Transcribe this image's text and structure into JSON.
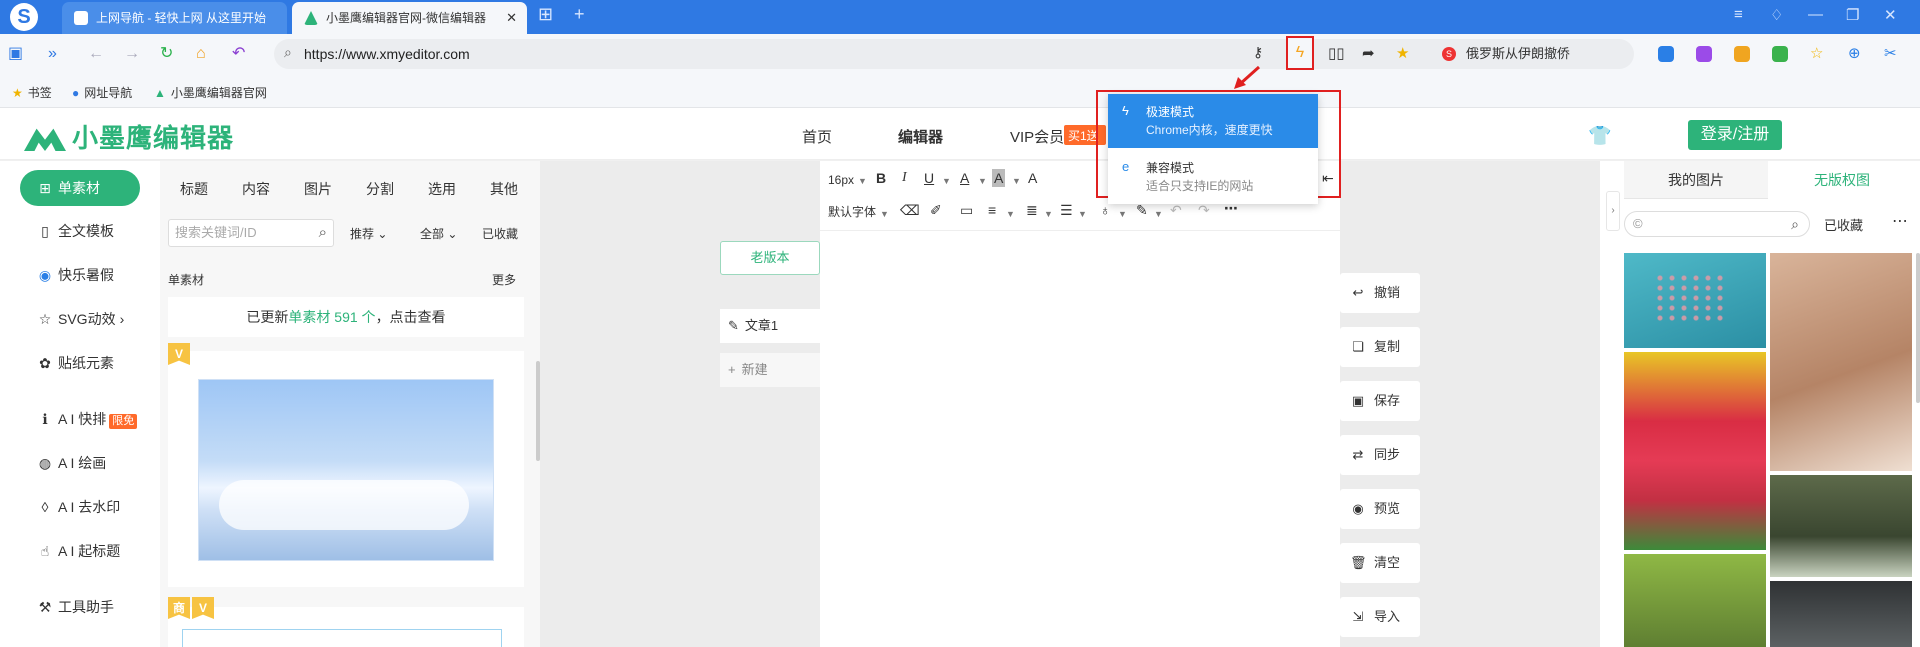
{
  "browser": {
    "tabs": [
      {
        "title": "上网导航 - 轻快上网 从这里开始"
      },
      {
        "title": "小墨鹰编辑器官网-微信编辑器"
      }
    ],
    "url": "https://www.xmyeditor.com",
    "search_text": "俄罗斯从伊朗撤侨",
    "bookmarks": [
      {
        "label": "书签"
      },
      {
        "label": "网址导航"
      },
      {
        "label": "小墨鹰编辑器官网"
      }
    ],
    "mode_menu": {
      "fast": {
        "title": "极速模式",
        "desc": "Chrome内核，速度更快"
      },
      "compat": {
        "title": "兼容模式",
        "desc": "适合只支持IE的网站"
      }
    }
  },
  "site": {
    "brand": "小墨鹰编辑器",
    "nav": [
      {
        "label": "首页"
      },
      {
        "label": "编辑器"
      },
      {
        "label": "VIP会员"
      }
    ],
    "vip_tag": "买1送1",
    "login_label": "登录/注册"
  },
  "left_nav": [
    {
      "label": "单素材",
      "icon": "grid-icon"
    },
    {
      "label": "全文模板",
      "icon": "template-icon"
    },
    {
      "label": "快乐暑假",
      "icon": "ball-icon"
    },
    {
      "label": "SVG动效",
      "icon": "star-icon"
    },
    {
      "label": "贴纸元素",
      "icon": "sticker-icon"
    },
    {
      "label": "A I 快排",
      "icon": "ai-icon",
      "badge": "限免"
    },
    {
      "label": "A I 绘画",
      "icon": "palette-icon"
    },
    {
      "label": "A I 去水印",
      "icon": "drop-icon"
    },
    {
      "label": "A I 起标题",
      "icon": "hand-icon"
    },
    {
      "label": "工具助手",
      "icon": "tool-icon"
    }
  ],
  "material": {
    "tabs": [
      {
        "label": "标题"
      },
      {
        "label": "内容"
      },
      {
        "label": "图片"
      },
      {
        "label": "分割"
      },
      {
        "label": "选用"
      },
      {
        "label": "其他"
      }
    ],
    "search_placeholder": "搜索关键词/ID",
    "filter_recommend": "推荐",
    "filter_all": "全部",
    "collected": "已收藏",
    "section_title": "单素材",
    "more": "更多",
    "notice_prefix": "已更新",
    "notice_highlight": "单素材 591 个",
    "notice_suffix": "，点击查看",
    "badge_v": "V",
    "badge_shang": "商"
  },
  "editor": {
    "old_version": "老版本",
    "doc_name": "文章1",
    "new_label": "新建",
    "font_size": "16px",
    "font_family": "默认字体",
    "actions": [
      {
        "label": "撤销",
        "icon": "undo-icon"
      },
      {
        "label": "复制",
        "icon": "copy-icon"
      },
      {
        "label": "保存",
        "icon": "save-icon"
      },
      {
        "label": "同步",
        "icon": "sync-icon"
      },
      {
        "label": "预览",
        "icon": "eye-icon"
      },
      {
        "label": "清空",
        "icon": "trash-icon"
      },
      {
        "label": "导入",
        "icon": "import-icon"
      }
    ]
  },
  "right_panel": {
    "tabs": [
      {
        "label": "我的图片"
      },
      {
        "label": "无版权图"
      }
    ],
    "search_placeholder": "©",
    "collected": "已收藏"
  },
  "colors": {
    "brand_green": "#2db37a",
    "browser_blue": "#2f79e3",
    "highlight_red": "#e02020",
    "menu_blue": "#2a8be8"
  }
}
